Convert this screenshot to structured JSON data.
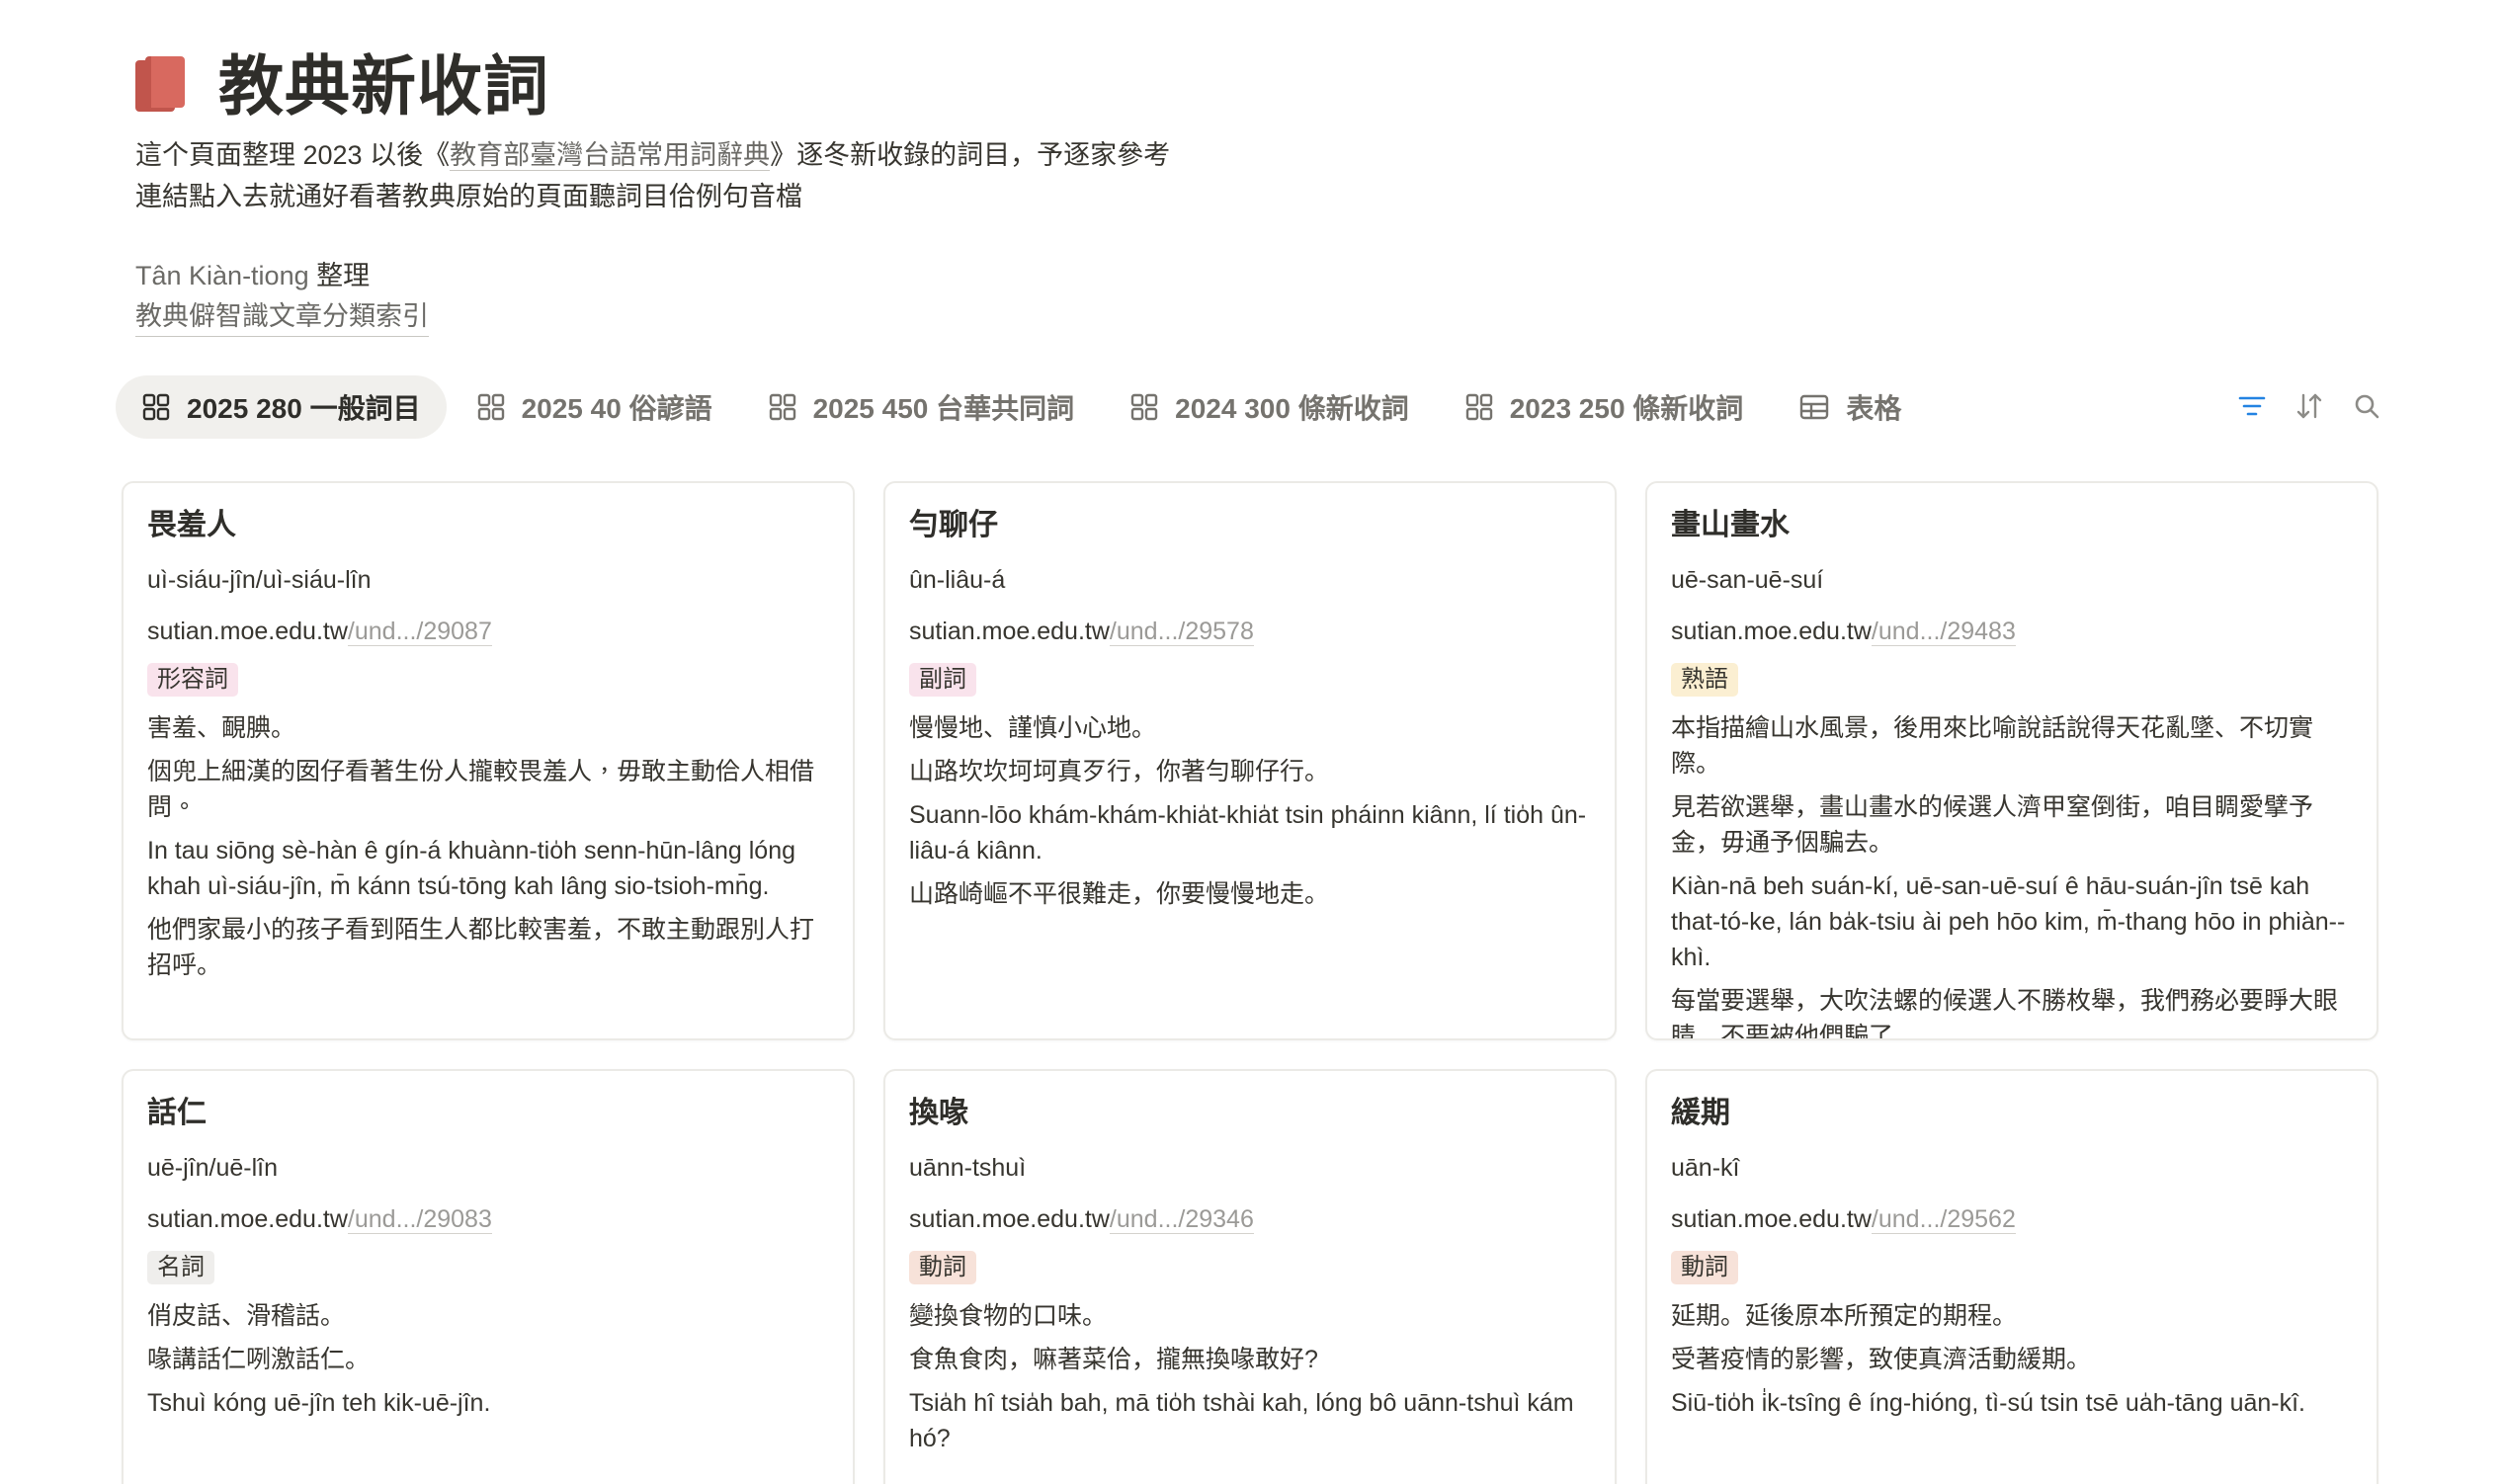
{
  "page": {
    "title": "教典新收詞",
    "desc1_a": "這个頁面整理 2023 以後《",
    "desc1_link": "教育部臺灣台語常用詞辭典",
    "desc1_b": "》逐冬新收錄的詞目，予逐家參考",
    "desc2": "連結點入去就通好看著教典原始的頁面聽詞目佮例句音檔",
    "author_name": "Tân Kiàn-tiong",
    "author_suffix": " 整理",
    "index_link": "教典僻智識文章分類索引"
  },
  "tabs": [
    {
      "label": "2025 280 一般詞目",
      "icon": "gallery-icon",
      "active": true
    },
    {
      "label": "2025 40 俗諺語",
      "icon": "gallery-icon",
      "active": false
    },
    {
      "label": "2025 450 台華共同詞",
      "icon": "gallery-icon",
      "active": false
    },
    {
      "label": "2024 300 條新收詞",
      "icon": "gallery-icon",
      "active": false
    },
    {
      "label": "2023 250 條新收詞",
      "icon": "gallery-icon",
      "active": false
    },
    {
      "label": "表格",
      "icon": "table-icon",
      "active": false
    }
  ],
  "toolbar": {
    "filter": "filter-icon",
    "sort": "sort-icon",
    "search": "search-icon",
    "accent": "#2383e2"
  },
  "cards": [
    {
      "word": "畏羞人",
      "romanization": "uì-siáu-jîn/uì-siáu-lîn",
      "url_host": "sutian.moe.edu.tw",
      "url_path": "/und.../29087",
      "tag": "形容詞",
      "tag_bg": "#f9e3ec",
      "lines": [
        "害羞、靦腆。",
        "𪜶兜上細漢的囡仔看著生份人攏較畏羞人，毋敢主動佮人相借問。",
        "In tau siōng sè-hàn ê gín-á khuànn-tio̍h senn-hūn-lâng lóng khah uì-siáu-jîn, m̄ kánn tsú-tōng kah lâng sio-tsioh-mn̄g.",
        "他們家最小的孩子看到陌生人都比較害羞，不敢主動跟別人打招呼。"
      ]
    },
    {
      "word": "勻聊仔",
      "romanization": "ûn-liâu-á",
      "url_host": "sutian.moe.edu.tw",
      "url_path": "/und.../29578",
      "tag": "副詞",
      "tag_bg": "#f9e3ec",
      "lines": [
        "慢慢地、謹慎小心地。",
        "山路坎坎坷坷真歹行，你著勻聊仔行。",
        "Suann-lōo khám-khám-khia̍t-khia̍t tsin pháinn kiânn, lí tio̍h ûn-liâu-á kiânn.",
        "山路崎嶇不平很難走，你要慢慢地走。"
      ]
    },
    {
      "word": "畫山畫水",
      "romanization": "uē-san-uē-suí",
      "url_host": "sutian.moe.edu.tw",
      "url_path": "/und.../29483",
      "tag": "熟語",
      "tag_bg": "#fbefd2",
      "lines": [
        "本指描繪山水風景，後用來比喻說話說得天花亂墜、不切實際。",
        "見若欲選舉，畫山畫水的候選人濟甲窒倒街，咱目睭愛擘予金，毋通予𪜶騙去。",
        "Kiàn-nā beh suán-kí, uē-san-uē-suí ê hāu-suán-jîn tsē kah that-tó-ke, lán ba̍k-tsiu ài peh hōo kim, m̄-thang hōo in phiàn--khì.",
        "每當要選舉，大吹法螺的候選人不勝枚舉，我們務必要睜大眼睛，不要被他們騙了。"
      ]
    },
    {
      "word": "話仁",
      "romanization": "uē-jîn/uē-lîn",
      "url_host": "sutian.moe.edu.tw",
      "url_path": "/und.../29083",
      "tag": "名詞",
      "tag_bg": "#efeeec",
      "lines": [
        "俏皮話、滑稽話。",
        "喙講話仁咧激話仁。",
        "Tshuì kóng uē-jîn teh kik-uē-jîn."
      ]
    },
    {
      "word": "換喙",
      "romanization": "uānn-tshuì",
      "url_host": "sutian.moe.edu.tw",
      "url_path": "/und.../29346",
      "tag": "動詞",
      "tag_bg": "#f7e2d9",
      "lines": [
        "變換食物的口味。",
        "食魚食肉，嘛著菜佮，攏無換喙敢好?",
        "Tsia̍h hî tsia̍h bah, mā tio̍h tshài kah, lóng bô uānn-tshuì kám hó?"
      ]
    },
    {
      "word": "緩期",
      "romanization": "uān-kî",
      "url_host": "sutian.moe.edu.tw",
      "url_path": "/und.../29562",
      "tag": "動詞",
      "tag_bg": "#f7e2d9",
      "lines": [
        "延期。延後原本所預定的期程。",
        "受著疫情的影響，致使真濟活動緩期。",
        "Siū-tio̍h i̍k-tsîng ê íng-hióng, tì-sú tsin tsē ua̍h-tāng uān-kî."
      ]
    }
  ]
}
